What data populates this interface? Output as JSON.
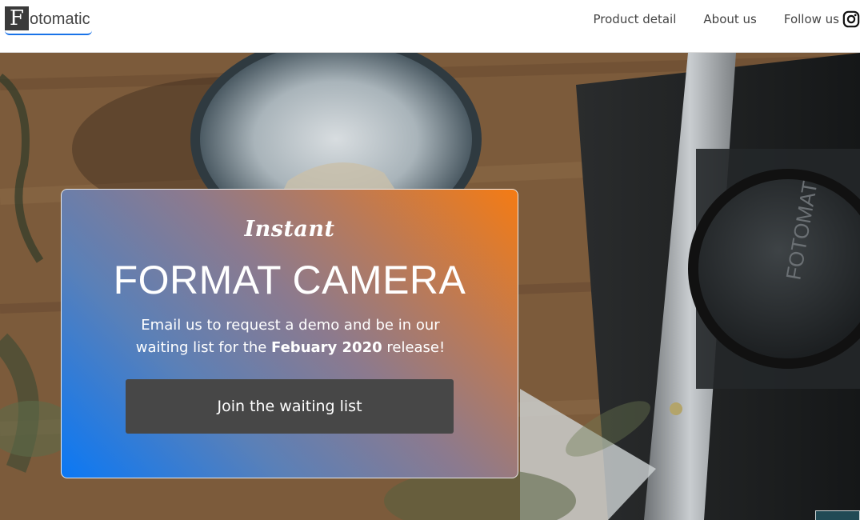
{
  "brand": {
    "mark": "F",
    "name": "otomatic"
  },
  "nav": {
    "items": [
      {
        "label": "Product detail"
      },
      {
        "label": "About us"
      },
      {
        "label": "Follow us"
      }
    ],
    "follow_icon": "instagram-icon"
  },
  "hero": {
    "background": "photo of a vintage Fotomatic camera and a ceramic bowl on a wooden table",
    "lens_cap_text": "FOTOMAT",
    "card": {
      "kicker": "Instant",
      "title": "FORMAT CAMERA",
      "desc_part1": "Email us to request a demo and be in our waiting list for the ",
      "desc_bold": "Febuary 2020",
      "desc_part2": " release!",
      "cta_label": "Join the waiting list"
    }
  },
  "colors": {
    "gradient_start": "#0a78f5",
    "gradient_end": "#f47b14",
    "button": "#474747",
    "accent_underline": "#1a73e8"
  }
}
